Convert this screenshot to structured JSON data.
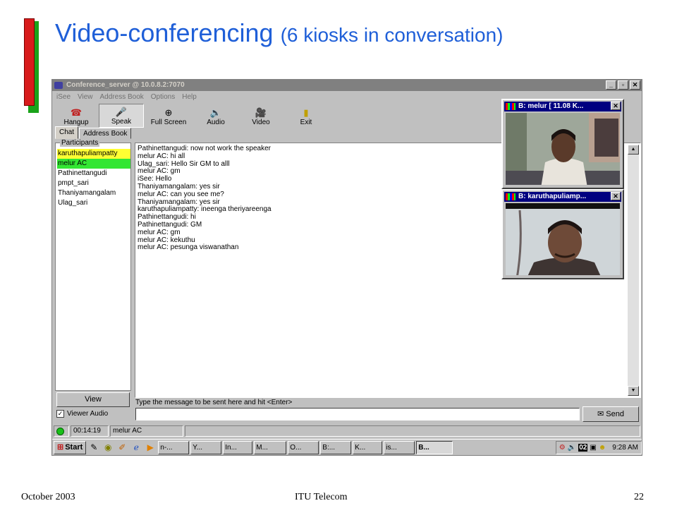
{
  "slide": {
    "title_main": "Video-conferencing",
    "title_sub": "(6 kiosks in conversation)",
    "footer_left": "October 2003",
    "footer_center": "ITU Telecom",
    "footer_right": "22"
  },
  "window": {
    "title": "Conference_server @ 10.0.8.2:7070",
    "buttons": [
      "_",
      "▫",
      "✕"
    ]
  },
  "menu": [
    "iSee",
    "View",
    "Address Book",
    "Options",
    "Help"
  ],
  "toolbar": {
    "hangup": "Hangup",
    "speak": "Speak",
    "full_screen": "Full Screen",
    "audio": "Audio",
    "video": "Video",
    "exit": "Exit"
  },
  "tabs": [
    "Chat",
    "Address Book"
  ],
  "participants": {
    "label": "Participants",
    "items": [
      {
        "name": "karuthapuliampatty",
        "highlight": "#ffff33"
      },
      {
        "name": "melur AC",
        "highlight": "#33e633"
      },
      {
        "name": "Pathinettangudi",
        "highlight": ""
      },
      {
        "name": "pmpt_sari",
        "highlight": ""
      },
      {
        "name": "Thaniyamangalam",
        "highlight": ""
      },
      {
        "name": "Ulag_sari",
        "highlight": ""
      }
    ]
  },
  "chat_lines": [
    "Pathinettangudi: now not work the speaker",
    "melur AC: hi all",
    "Ulag_sari: Hello Sir GM to alll",
    "melur AC: gm",
    "iSee: Hello",
    "Thaniyamangalam: yes sir",
    "melur AC: can you see me?",
    "Thaniyamangalam: yes sir",
    "karuthapuliampatty: ineenga   theriyareenga",
    "Pathinettangudi: hi",
    "Pathinettangudi: GM",
    "melur AC: gm",
    "melur AC: kekuthu",
    "melur AC: pesunga viswanathan"
  ],
  "view_button": "View",
  "viewer_audio": {
    "label": "Viewer Audio",
    "checked": "✓"
  },
  "message": {
    "hint": "Type the message to be sent here and hit <Enter>",
    "value": "",
    "send_label": "Send"
  },
  "status": {
    "time": "00:14:19",
    "speaker": "melur AC"
  },
  "taskbar": {
    "start": "Start",
    "tasks": [
      "n-...",
      "Y...",
      "In...",
      "M...",
      "O...",
      "B:...",
      "K...",
      "is...",
      "B..."
    ],
    "clock": "9:28 AM",
    "tray_badge": "02"
  },
  "video_windows": [
    {
      "title": "B:  melur  [ 11.08 K..."
    },
    {
      "title": "B:  karuthapuliamp..."
    }
  ]
}
